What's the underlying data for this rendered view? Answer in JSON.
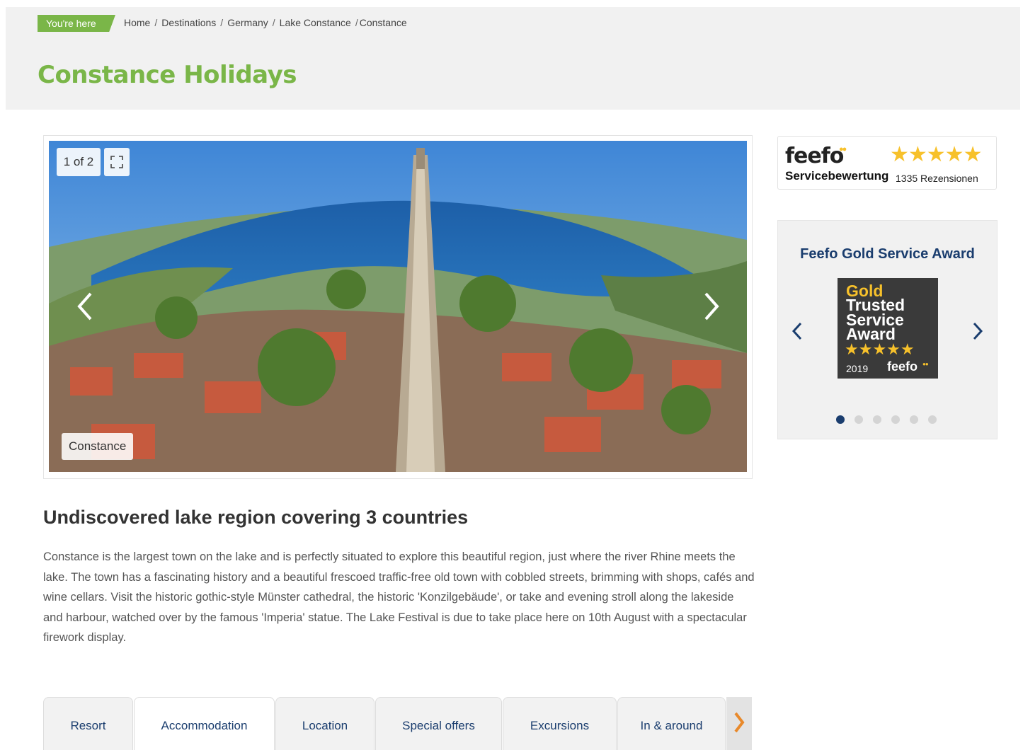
{
  "breadcrumb": {
    "label": "You're here",
    "items": [
      "Home",
      "Destinations",
      "Germany",
      "Lake Constance",
      "Constance"
    ],
    "separator": "/"
  },
  "page_title": "Constance Holidays",
  "gallery": {
    "counter": "1 of 2",
    "caption": "Constance",
    "icons": [
      "fullscreen-icon",
      "chevron-left-icon",
      "chevron-right-icon"
    ]
  },
  "feefo": {
    "logo": "feefo",
    "service_label": "Servicebewertung",
    "reviews": "1335 Rezensionen",
    "stars": 5
  },
  "award": {
    "title": "Feefo Gold Service Award",
    "badge_gold": "Gold",
    "badge_text": "Trusted Service Award",
    "badge_year": "2019",
    "badge_brand": "feefo",
    "dots_total": 6,
    "dots_active": 1
  },
  "section": {
    "heading": "Undiscovered lake region covering 3 countries",
    "text": "Constance is the largest town on the lake and is perfectly situated to explore this beautiful region, just where the river Rhine meets the lake. The town has a fascinating history and a beautiful frescoed traffic-free old town with cobbled streets, brimming with shops, cafés and wine cellars. Visit the historic gothic-style Münster cathedral, the historic 'Konzilgebäude', or take and evening stroll along the lakeside and harbour, watched over by the famous 'Imperia' statue. The Lake Festival is due to take place here on 10th August with a spectacular firework display."
  },
  "tabs": {
    "items": [
      "Resort",
      "Accommodation",
      "Location",
      "Special offers",
      "Excursions",
      "In & around"
    ],
    "active": "Accommodation"
  },
  "colors": {
    "brand_green": "#7ab648",
    "navy": "#1a3d6e",
    "star_gold": "#f7c12b",
    "orange_arrow": "#e8892b"
  }
}
